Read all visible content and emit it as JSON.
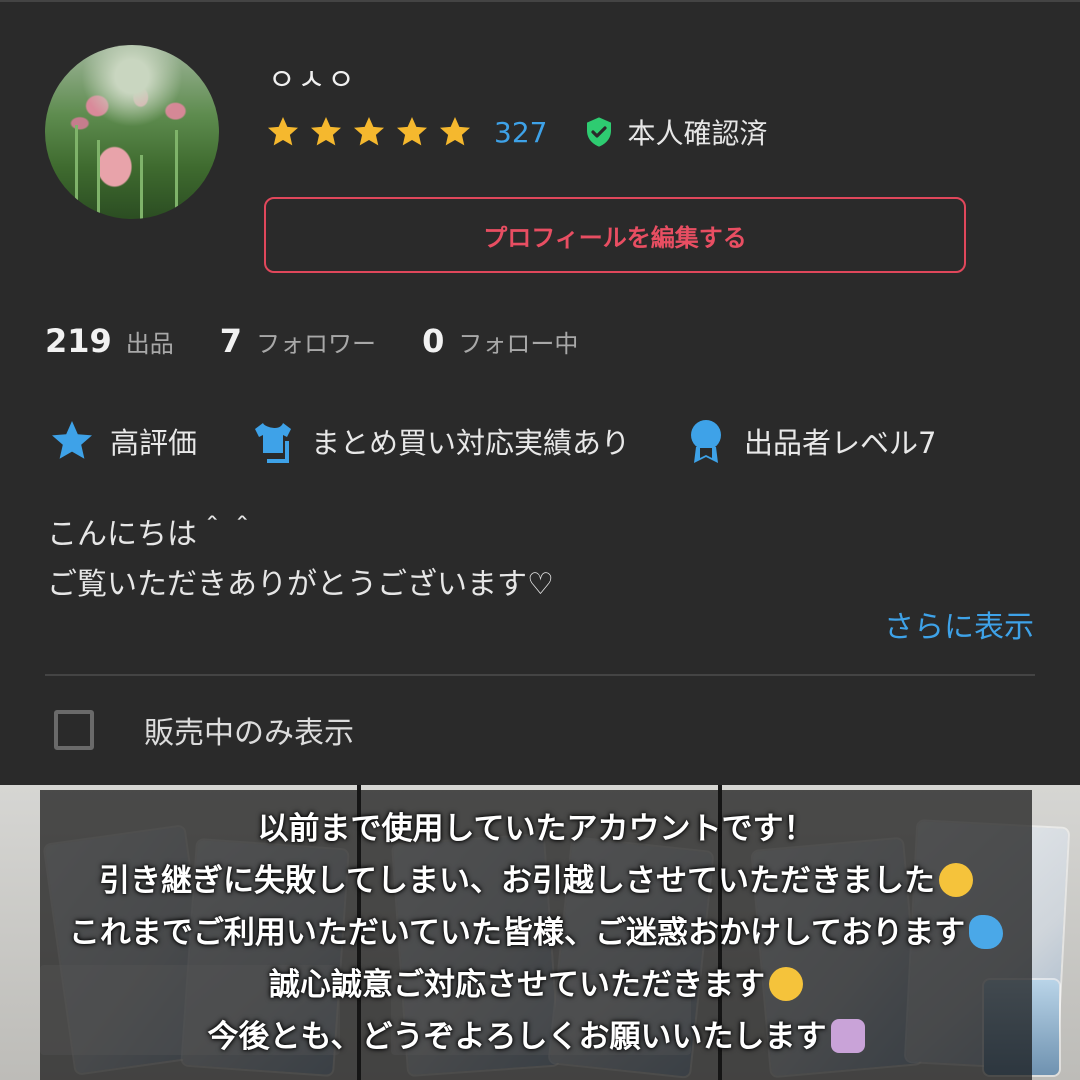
{
  "profile": {
    "username": "ㅇㅅㅇ",
    "rating_stars": 5,
    "review_count": "327",
    "verified_label": "本人確認済",
    "edit_button": "プロフィールを編集する"
  },
  "stats": [
    {
      "value": "219",
      "label": "出品"
    },
    {
      "value": "7",
      "label": "フォロワー"
    },
    {
      "value": "0",
      "label": "フォロー中"
    }
  ],
  "badges": [
    {
      "icon": "star-icon",
      "label": "高評価"
    },
    {
      "icon": "tshirt-icon",
      "label": "まとめ買い対応実績あり"
    },
    {
      "icon": "medal-icon",
      "label": "出品者レベル7"
    }
  ],
  "bio": {
    "line1": "こんにちは＾＾",
    "line2": "ご覧いただきありがとうございます♡",
    "more_link": "さらに表示"
  },
  "filter": {
    "label": "販売中のみ表示",
    "checked": false
  },
  "notice": {
    "line1": "以前まで使用していたアカウントです！",
    "line2": "引き継ぎに失敗してしまい、お引越しさせていただきました",
    "line3": "これまでご利用いただいていた皆様、ご迷惑おかけしております",
    "line4": "誠心誠意ご対応させていただきます",
    "line5": "今後とも、どうぞよろしくお願いいたします"
  },
  "colors": {
    "background": "#2a2a2a",
    "accent_blue": "#3ea2e8",
    "accent_red": "#e0475b",
    "star_gold": "#f5b82e",
    "verified_green": "#2ecc71"
  }
}
